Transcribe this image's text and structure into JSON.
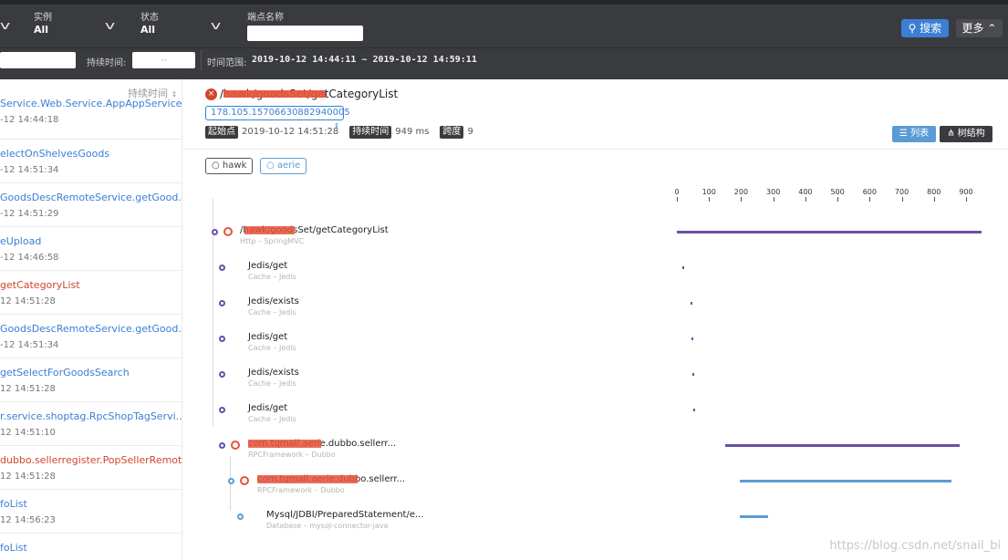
{
  "filters": {
    "instance": {
      "label": "实例",
      "value": "All"
    },
    "status": {
      "label": "状态",
      "value": "All"
    },
    "endpoint": {
      "label": "端点名称",
      "value": ""
    },
    "search_label": "搜索",
    "more_label": "更多",
    "duration_label": "持续时间:",
    "duration_placeholder": "--",
    "time_range_label": "时间范围:",
    "time_range_value": "2019-10-12 14:44:11 ~ 2019-10-12 14:59:11"
  },
  "trace_list": {
    "header": "持续时间",
    "items": [
      {
        "title": "Service.Web.Service.AppAppService.GetService",
        "time": "-12 14:44:18",
        "error": false
      },
      {
        "title": "electOnShelvesGoods",
        "time": "-12 14:51:34",
        "error": false
      },
      {
        "title": "GoodsDescRemoteService.getGood...",
        "time": "-12 14:51:29",
        "error": false
      },
      {
        "title": "eUpload",
        "time": "-12 14:46:58",
        "error": false
      },
      {
        "title": "getCategoryList",
        "time": "12 14:51:28",
        "error": true
      },
      {
        "title": "GoodsDescRemoteService.getGood...",
        "time": "-12 14:51:34",
        "error": false
      },
      {
        "title": "getSelectForGoodsSearch",
        "time": "12 14:51:28",
        "error": false
      },
      {
        "title": "r.service.shoptag.RpcShopTagServi...",
        "time": "12 14:51:10",
        "error": false
      },
      {
        "title": "dubbo.sellerregister.PopSellerRemot...",
        "time": "12 14:51:28",
        "error": true
      },
      {
        "title": "foList",
        "time": "12 14:56:23",
        "error": false
      },
      {
        "title": "foList",
        "time": "",
        "error": false
      }
    ]
  },
  "detail": {
    "title": "/hawk/goodsSet/getCategoryList",
    "trace_id": "178.105.15706630882940005",
    "start_label": "起始点",
    "start_value": "2019-10-12 14:51:28",
    "duration_label": "持续时间",
    "duration_value": "949 ms",
    "span_label": "跨度",
    "span_value": "9",
    "list_btn": "列表",
    "tree_btn": "树结构",
    "services": [
      "hawk",
      "aerie"
    ],
    "axis_ticks": [
      "0",
      "100",
      "200",
      "300",
      "400",
      "500",
      "600",
      "700",
      "800",
      "900"
    ],
    "accent_purple": "#6a4fa8",
    "accent_blue": "#5b9bd5"
  },
  "spans": [
    {
      "name": "/hawk/goodsSet/getCategoryList",
      "sub": "Http – SpringMVC",
      "error": true,
      "start": 0,
      "end": 949
    },
    {
      "name": "Jedis/get",
      "sub": "Cache – Jedis",
      "error": false,
      "start": 18,
      "end": 21
    },
    {
      "name": "Jedis/exists",
      "sub": "Cache – Jedis",
      "error": false,
      "start": 42,
      "end": 45
    },
    {
      "name": "Jedis/get",
      "sub": "Cache – Jedis",
      "error": false,
      "start": 45,
      "end": 48
    },
    {
      "name": "Jedis/exists",
      "sub": "Cache – Jedis",
      "error": false,
      "start": 47,
      "end": 50
    },
    {
      "name": "Jedis/get",
      "sub": "Cache – Jedis",
      "error": false,
      "start": 50,
      "end": 53
    },
    {
      "name": "com.tqmall.aerie.dubbo.sellerr...",
      "sub": "RPCFramework – Dubbo",
      "error": true,
      "start": 150,
      "end": 880
    },
    {
      "name": "com.tqmall.aerie.dubbo.sellerr...",
      "sub": "RPCFramework – Dubbo",
      "error": true,
      "start": 195,
      "end": 855
    },
    {
      "name": "Mysql/JDBI/PreparedStatement/e...",
      "sub": "Database – mysql-connector-java",
      "error": false,
      "start": 195,
      "end": 285
    }
  ],
  "watermark": "https://blog.csdn.net/snail_bi"
}
